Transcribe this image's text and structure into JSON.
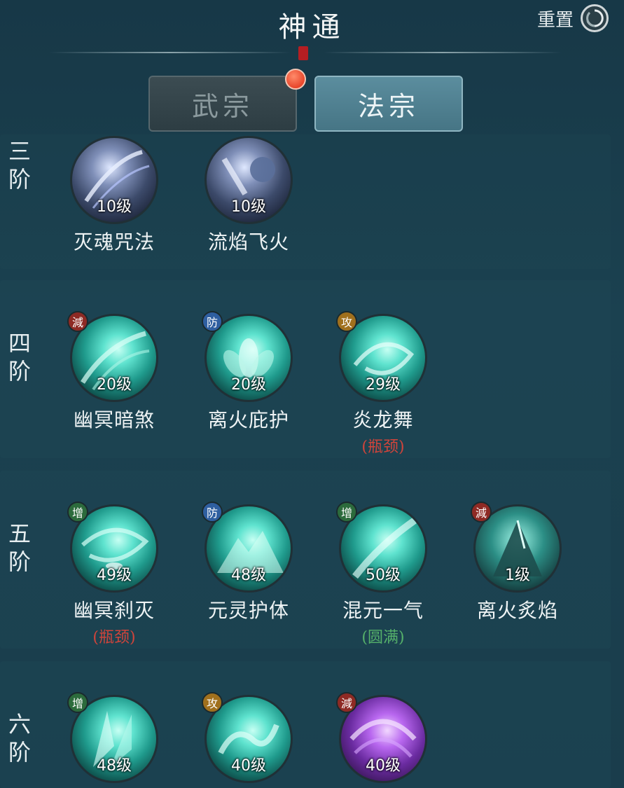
{
  "header": {
    "title": "神通",
    "reset_label": "重置"
  },
  "tabs": [
    {
      "label": "武宗"
    },
    {
      "label": "法宗"
    }
  ],
  "colors": {
    "accent": "#5b8d9e",
    "bottleneck": "#d0443b",
    "complete": "#55b06a",
    "notification": "#e8462b"
  },
  "tiers": [
    {
      "label": "三\n阶",
      "skills": [
        {
          "name": "灭魂咒法",
          "level": "10级",
          "badge": "",
          "status": "",
          "icon": "shadow-slash-icon"
        },
        {
          "name": "流焰飞火",
          "level": "10级",
          "badge": "",
          "status": "",
          "icon": "fist-strike-icon"
        }
      ]
    },
    {
      "label": "四\n阶",
      "skills": [
        {
          "name": "幽冥暗煞",
          "level": "20级",
          "badge": "減",
          "status": "",
          "icon": "claw-slash-icon"
        },
        {
          "name": "离火庇护",
          "level": "20级",
          "badge": "防",
          "status": "",
          "icon": "lotus-icon"
        },
        {
          "name": "炎龙舞",
          "level": "29级",
          "badge": "攻",
          "status": "(瓶颈)",
          "icon": "vortex-icon"
        }
      ]
    },
    {
      "label": "五\n阶",
      "skills": [
        {
          "name": "幽冥刹灭",
          "level": "49级",
          "badge": "增",
          "status": "(瓶颈)",
          "icon": "whirlwind-icon"
        },
        {
          "name": "元灵护体",
          "level": "48级",
          "badge": "防",
          "status": "",
          "icon": "mountain-shield-icon"
        },
        {
          "name": "混元一气",
          "level": "50级",
          "badge": "增",
          "status": "(圆满)",
          "icon": "energy-slash-icon"
        },
        {
          "name": "离火炙焰",
          "level": "1级",
          "badge": "減",
          "status": "",
          "icon": "ice-peak-icon"
        }
      ]
    },
    {
      "label": "六\n阶",
      "skills": [
        {
          "name": "",
          "level": "48级",
          "badge": "增",
          "status": "",
          "icon": "crystal-shards-icon"
        },
        {
          "name": "",
          "level": "40级",
          "badge": "攻",
          "status": "",
          "icon": "water-dragon-icon"
        },
        {
          "name": "",
          "level": "40级",
          "badge": "減",
          "status": "",
          "icon": "purple-vortex-icon"
        }
      ]
    }
  ]
}
